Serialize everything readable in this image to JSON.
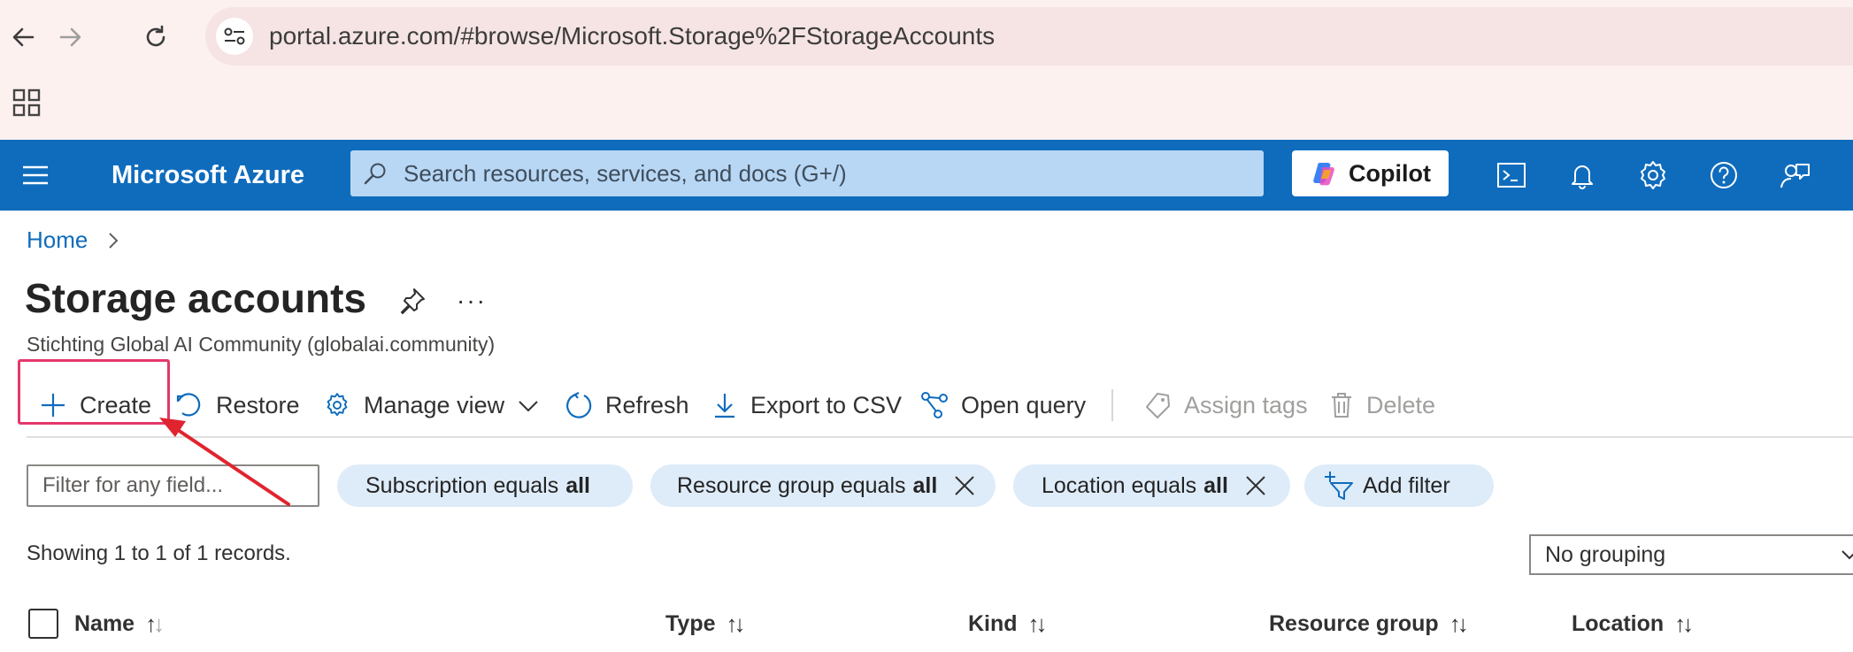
{
  "browser": {
    "url": "portal.azure.com/#browse/Microsoft.Storage%2FStorageAccounts",
    "icons": [
      "back-icon",
      "forward-icon",
      "reload-icon",
      "site-info-icon",
      "apps-grid-icon"
    ]
  },
  "azure_header": {
    "brand": "Microsoft Azure",
    "search_placeholder": "Search resources, services, and docs (G+/)",
    "copilot_label": "Copilot",
    "icons": [
      "cloud-shell-icon",
      "notifications-icon",
      "settings-icon",
      "help-icon",
      "feedback-icon"
    ]
  },
  "breadcrumb": {
    "home": "Home"
  },
  "page": {
    "title": "Storage accounts",
    "more": "···",
    "subtitle": "Stichting Global AI Community (globalai.community)"
  },
  "commands": {
    "create": "Create",
    "restore": "Restore",
    "manage_view": "Manage view",
    "refresh": "Refresh",
    "export_csv": "Export to CSV",
    "open_query": "Open query",
    "assign_tags": "Assign tags",
    "delete": "Delete"
  },
  "filters": {
    "placeholder": "Filter for any field...",
    "subscription": {
      "label": "Subscription equals",
      "value": "all"
    },
    "resource_group": {
      "label": "Resource group equals",
      "value": "all"
    },
    "location": {
      "label": "Location equals",
      "value": "all"
    },
    "add_filter": "Add filter"
  },
  "records": "Showing 1 to 1 of 1 records.",
  "grouping": "No grouping",
  "table": {
    "columns": [
      "Name",
      "Type",
      "Kind",
      "Resource group",
      "Location"
    ]
  },
  "colors": {
    "azure_blue": "#0f6cbd",
    "highlight": "#e4386a",
    "arrow": "#e0242f"
  }
}
